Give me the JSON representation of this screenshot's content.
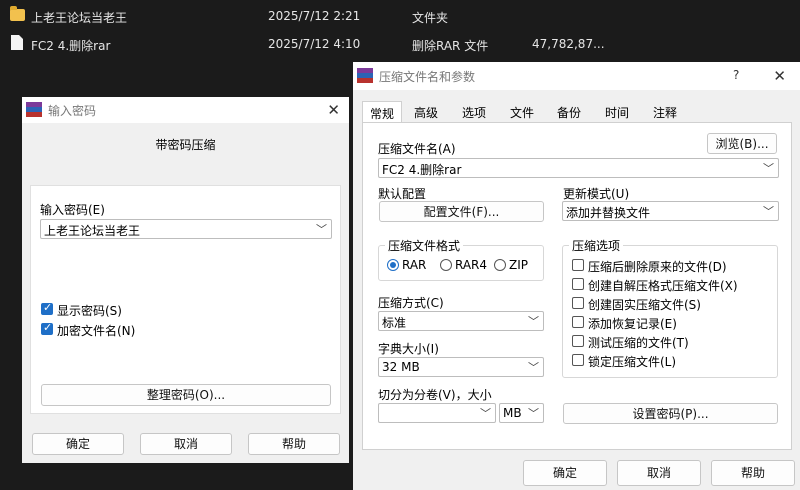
{
  "explorer": {
    "rows": [
      {
        "name": "上老王论坛当老王",
        "date": "2025/7/12 2:21",
        "type": "文件夹",
        "size": "",
        "icon": "folder-icon"
      },
      {
        "name": "FC2 4.删除rar",
        "date": "2025/7/12 4:10",
        "type": "删除RAR 文件",
        "size": "47,782,87...",
        "icon": "file-icon"
      }
    ]
  },
  "password_dialog": {
    "title": "输入密码",
    "heading": "带密码压缩",
    "password_label": "输入密码(E)",
    "password_value": "上老王论坛当老王",
    "show_password": "显示密码(S)",
    "encrypt_names": "加密文件名(N)",
    "organize_button": "整理密码(O)...",
    "ok": "确定",
    "cancel": "取消",
    "help": "帮助"
  },
  "archive_dialog": {
    "title": "压缩文件名和参数",
    "help_mark": "?",
    "tabs": [
      "常规",
      "高级",
      "选项",
      "文件",
      "备份",
      "时间",
      "注释"
    ],
    "archive_name_label": "压缩文件名(A)",
    "browse_button": "浏览(B)...",
    "archive_name_value": "FC2 4.删除rar",
    "default_profile_label": "默认配置",
    "profiles_button": "配置文件(F)...",
    "update_mode_label": "更新模式(U)",
    "update_mode_value": "添加并替换文件",
    "format_group": "压缩文件格式",
    "formats": [
      "RAR",
      "RAR4",
      "ZIP"
    ],
    "options_group": "压缩选项",
    "options": [
      "压缩后删除原来的文件(D)",
      "创建自解压格式压缩文件(X)",
      "创建固实压缩文件(S)",
      "添加恢复记录(E)",
      "测试压缩的文件(T)",
      "锁定压缩文件(L)"
    ],
    "method_label": "压缩方式(C)",
    "method_value": "标准",
    "dict_label": "字典大小(I)",
    "dict_value": "32 MB",
    "split_label": "切分为分卷(V)，大小",
    "split_unit": "MB",
    "set_password_button": "设置密码(P)...",
    "ok": "确定",
    "cancel": "取消",
    "help": "帮助"
  },
  "colors": {
    "accent": "#1f6fc7",
    "background": "#1b1b1b",
    "window": "#f0f0f0"
  }
}
